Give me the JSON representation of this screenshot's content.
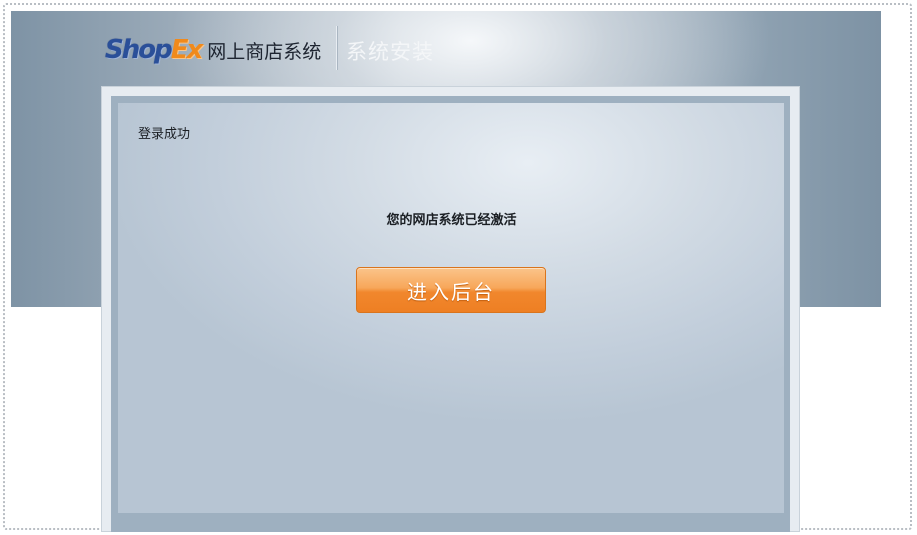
{
  "header": {
    "logo_shop": "Shop",
    "logo_ex": "Ex",
    "product_name": "网上商店系统",
    "section_title": "系统安装"
  },
  "panel": {
    "login_status": "登录成功",
    "activation_message": "您的网店系统已经激活",
    "enter_button_label": "进入后台"
  },
  "colors": {
    "button_orange": "#f1872d",
    "logo_blue": "#2a4f99",
    "logo_orange": "#f08a1c"
  }
}
